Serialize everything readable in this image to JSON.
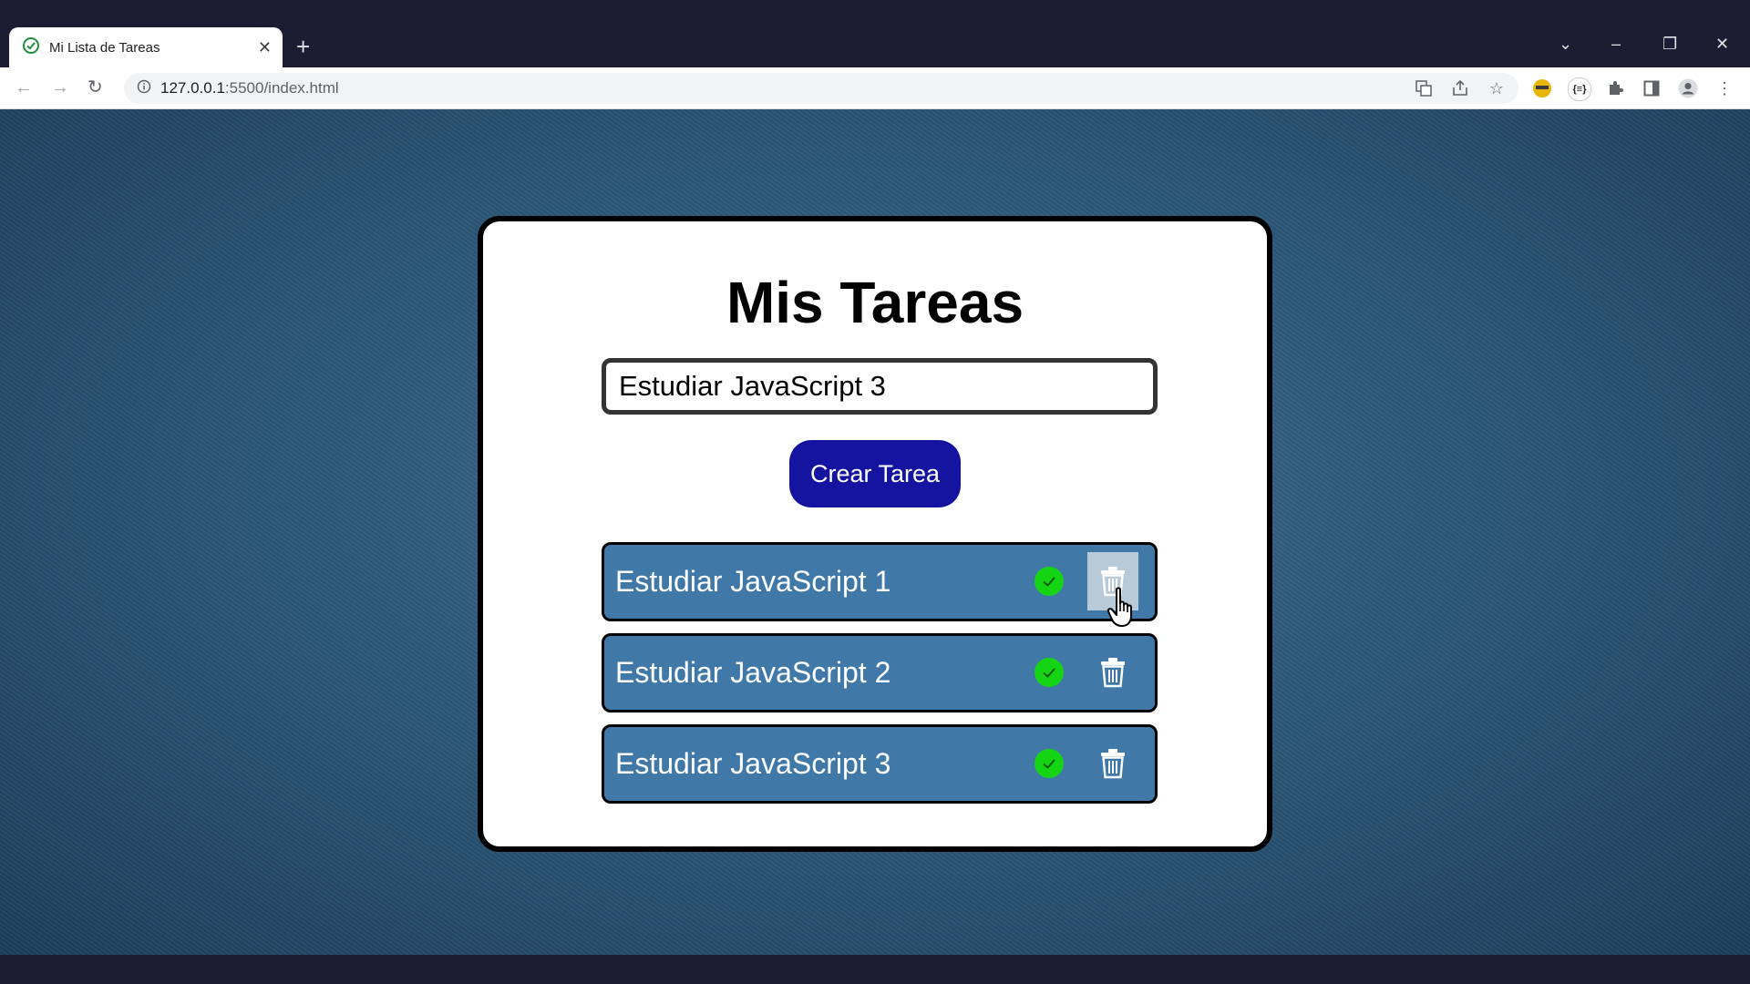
{
  "browser": {
    "tab_title": "Mi Lista de Tareas",
    "url_host": "127.0.0.1",
    "url_rest": ":5500/index.html"
  },
  "app": {
    "title": "Mis Tareas",
    "input_value": "Estudiar JavaScript 3",
    "create_button": "Crear Tarea",
    "tasks": [
      {
        "label": "Estudiar JavaScript 1"
      },
      {
        "label": "Estudiar JavaScript 2"
      },
      {
        "label": "Estudiar JavaScript 3"
      }
    ],
    "colors": {
      "button": "#1414a0",
      "task_bg": "#4079a8",
      "check": "#14d414"
    }
  },
  "icons": [
    "check-circle-icon",
    "trash-icon",
    "pointer-cursor-icon"
  ]
}
